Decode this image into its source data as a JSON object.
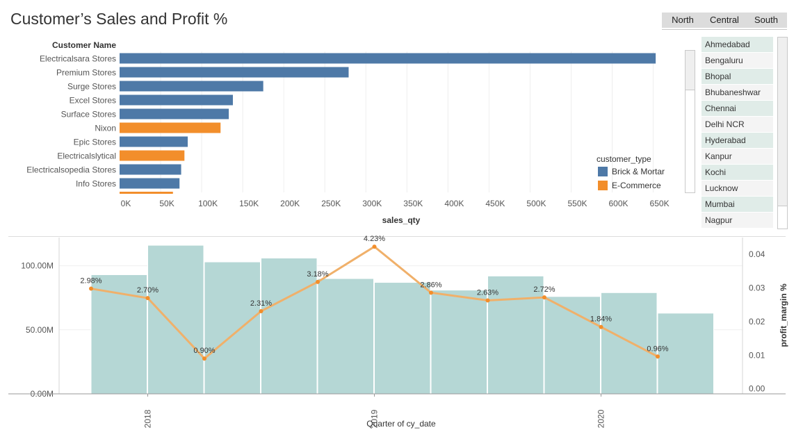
{
  "title": "Customer’s Sales and Profit %",
  "region_tabs": [
    "North",
    "Central",
    "South"
  ],
  "cities": [
    "Ahmedabad",
    "Bengaluru",
    "Bhopal",
    "Bhubaneshwar",
    "Chennai",
    "Delhi NCR",
    "Hyderabad",
    "Kanpur",
    "Kochi",
    "Lucknow",
    "Mumbai",
    "Nagpur"
  ],
  "legend": {
    "title": "customer_type",
    "items": [
      {
        "label": "Brick & Mortar",
        "color": "#4e79a7"
      },
      {
        "label": "E-Commerce",
        "color": "#f28e2b"
      }
    ]
  },
  "chart_data": [
    {
      "type": "bar",
      "orientation": "horizontal",
      "category_header": "Customer Name",
      "xlabel": "sales_qty",
      "xlim": [
        0,
        680000
      ],
      "xticks": [
        0,
        50000,
        100000,
        150000,
        200000,
        250000,
        300000,
        350000,
        400000,
        450000,
        500000,
        550000,
        600000,
        650000
      ],
      "xtick_labels": [
        "0K",
        "50K",
        "100K",
        "150K",
        "200K",
        "250K",
        "300K",
        "350K",
        "400K",
        "450K",
        "500K",
        "550K",
        "600K",
        "650K"
      ],
      "categories": [
        "Electricalsara Stores",
        "Premium Stores",
        "Surge Stores",
        "Excel Stores",
        "Surface Stores",
        "Nixon",
        "Epic Stores",
        "Electricalslytical",
        "Electricalsopedia Stores",
        "Info Stores",
        ""
      ],
      "values": [
        653000,
        279000,
        175000,
        138000,
        133000,
        123000,
        83000,
        79000,
        75000,
        73000,
        65000
      ],
      "customer_type": [
        "Brick & Mortar",
        "Brick & Mortar",
        "Brick & Mortar",
        "Brick & Mortar",
        "Brick & Mortar",
        "E-Commerce",
        "Brick & Mortar",
        "E-Commerce",
        "Brick & Mortar",
        "Brick & Mortar",
        "E-Commerce"
      ],
      "grid": true
    },
    {
      "type": "bar+line",
      "xlabel": "Quarter of cy_date",
      "x": [
        "2017 Q4",
        "2018 Q1",
        "2018 Q2",
        "2018 Q3",
        "2018 Q4",
        "2019 Q1",
        "2019 Q2",
        "2019 Q3",
        "2019 Q4",
        "2020 Q1",
        "2020 Q2"
      ],
      "xtick_labels": [
        "2018",
        "2019",
        "2020"
      ],
      "bars": {
        "name": "sales",
        "values": [
          93000000,
          116000000,
          103000000,
          106000000,
          90000000,
          87000000,
          81000000,
          92000000,
          76000000,
          79000000,
          63000000
        ],
        "ylim": [
          0,
          122000000
        ],
        "yticks": [
          0,
          50000000,
          100000000
        ],
        "ytick_labels": [
          "0.00M",
          "50.00M",
          "100.00M"
        ],
        "color": "#b5d7d5"
      },
      "line": {
        "name": "profit_margin %",
        "values": [
          0.0298,
          0.027,
          0.009,
          0.0231,
          0.0318,
          0.0423,
          0.0286,
          0.0263,
          0.0272,
          0.0184,
          0.0096
        ],
        "labels": [
          "2.98%",
          "2.70%",
          "0.90%",
          "2.31%",
          "3.18%",
          "4.23%",
          "2.86%",
          "2.63%",
          "2.72%",
          "1.84%",
          "0.96%"
        ],
        "ylabel": "profit_margin %",
        "ylim": [
          -0.0015,
          0.045
        ],
        "yticks": [
          0,
          0.01,
          0.02,
          0.03,
          0.04
        ],
        "ytick_labels": [
          "0.00",
          "0.01",
          "0.02",
          "0.03",
          "0.04"
        ],
        "color": "#f0b06a"
      },
      "grid": true
    }
  ]
}
